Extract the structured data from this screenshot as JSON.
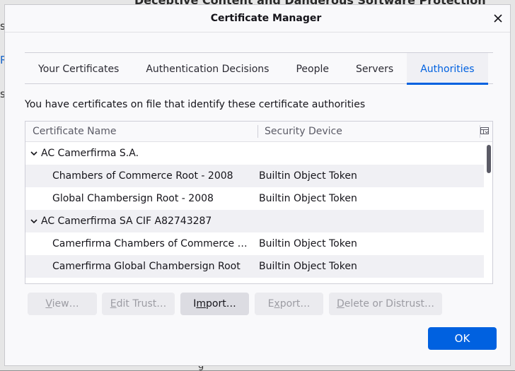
{
  "background": {
    "heading": "Deceptive Content and Dangerous Software Protection",
    "fragments": [
      "s",
      "R",
      "s",
      "g"
    ]
  },
  "dialog": {
    "title": "Certificate Manager",
    "close_icon": "close-icon",
    "tabs": [
      {
        "label": "Your Certificates",
        "active": false
      },
      {
        "label": "Authentication Decisions",
        "active": false
      },
      {
        "label": "People",
        "active": false
      },
      {
        "label": "Servers",
        "active": false
      },
      {
        "label": "Authorities",
        "active": true
      }
    ],
    "description": "You have certificates on file that identify these certificate authorities",
    "tree": {
      "columns": {
        "name": "Certificate Name",
        "device": "Security Device"
      },
      "rows": [
        {
          "type": "group",
          "name": "AC Camerfirma S.A.",
          "device": ""
        },
        {
          "type": "child",
          "name": "Chambers of Commerce Root - 2008",
          "device": "Builtin Object Token"
        },
        {
          "type": "child",
          "name": "Global Chambersign Root - 2008",
          "device": "Builtin Object Token"
        },
        {
          "type": "group",
          "name": "AC Camerfirma SA CIF A82743287",
          "device": ""
        },
        {
          "type": "child",
          "name": "Camerfirma Chambers of Commerce Root",
          "device": "Builtin Object Token"
        },
        {
          "type": "child",
          "name": "Camerfirma Global Chambersign Root",
          "device": "Builtin Object Token"
        }
      ]
    },
    "buttons": {
      "view": {
        "key": "V",
        "rest": "iew…",
        "enabled": false
      },
      "edit_trust": {
        "key": "E",
        "rest": "dit Trust…",
        "enabled": false
      },
      "import": {
        "pre": "I",
        "key": "m",
        "rest": "port…",
        "enabled": true
      },
      "export": {
        "key": "x",
        "pre": "E",
        "rest": "port…",
        "enabled": false
      },
      "delete": {
        "key": "D",
        "rest": "elete or Distrust…",
        "enabled": false
      }
    },
    "ok_label": "OK"
  },
  "colors": {
    "accent": "#0061e0"
  }
}
